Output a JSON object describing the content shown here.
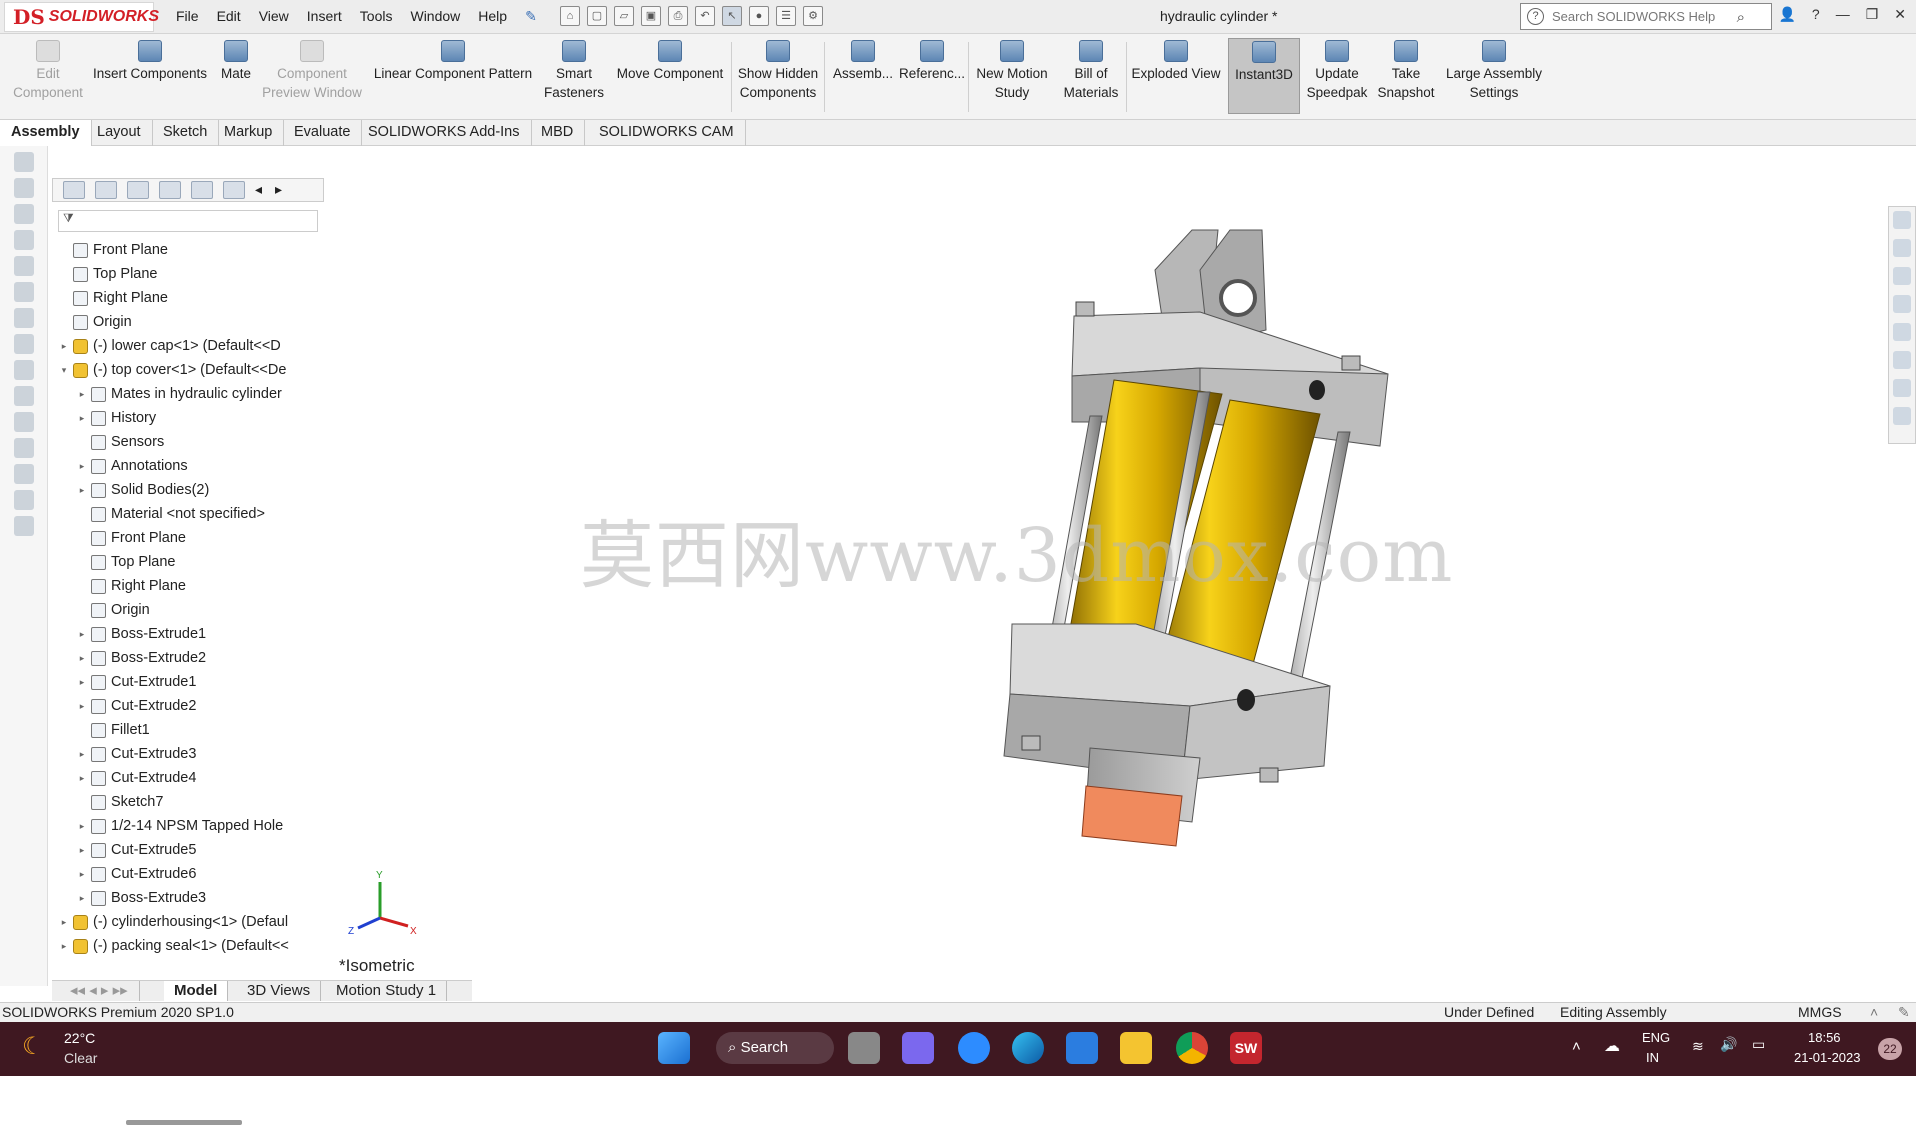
{
  "app": {
    "logo_mark": "DS",
    "logo_text": "SOLIDWORKS",
    "document_title": "hydraulic cylinder *",
    "menus": [
      "File",
      "Edit",
      "View",
      "Insert",
      "Tools",
      "Window",
      "Help"
    ],
    "search_placeholder": "Search SOLIDWORKS Help"
  },
  "ribbon": {
    "edit_component": [
      "Edit",
      "Component"
    ],
    "insert_components": "Insert Components",
    "mate": "Mate",
    "component_preview": [
      "Component",
      "Preview Window"
    ],
    "linear_pattern": "Linear Component Pattern",
    "smart_fasteners": [
      "Smart",
      "Fasteners"
    ],
    "move_component": "Move Component",
    "show_hidden": [
      "Show Hidden",
      "Components"
    ],
    "assembly": "Assemb...",
    "reference": "Referenc...",
    "new_motion_study": [
      "New Motion",
      "Study"
    ],
    "bill_of_materials": [
      "Bill of",
      "Materials"
    ],
    "exploded_view": "Exploded View",
    "instant3d": "Instant3D",
    "update_speedpak": [
      "Update",
      "Speedpak"
    ],
    "take_snapshot": [
      "Take",
      "Snapshot"
    ],
    "large_assembly": [
      "Large Assembly",
      "Settings"
    ]
  },
  "command_tabs": [
    "Assembly",
    "Layout",
    "Sketch",
    "Markup",
    "Evaluate",
    "SOLIDWORKS Add-Ins",
    "MBD",
    "SOLIDWORKS CAM"
  ],
  "feature_tree": {
    "items": [
      {
        "label": "Front Plane",
        "level": 0,
        "toggle": ""
      },
      {
        "label": "Top Plane",
        "level": 0,
        "toggle": ""
      },
      {
        "label": "Right Plane",
        "level": 0,
        "toggle": ""
      },
      {
        "label": "Origin",
        "level": 0,
        "toggle": ""
      },
      {
        "label": "(-) lower cap<1> (Default<<D",
        "level": 0,
        "toggle": "▸",
        "part": true
      },
      {
        "label": "(-) top cover<1> (Default<<De",
        "level": 0,
        "toggle": "▾",
        "part": true
      },
      {
        "label": "Mates in hydraulic cylinder",
        "level": 1,
        "toggle": "▸"
      },
      {
        "label": "History",
        "level": 1,
        "toggle": "▸"
      },
      {
        "label": "Sensors",
        "level": 1,
        "toggle": ""
      },
      {
        "label": "Annotations",
        "level": 1,
        "toggle": "▸"
      },
      {
        "label": "Solid Bodies(2)",
        "level": 1,
        "toggle": "▸"
      },
      {
        "label": "Material <not specified>",
        "level": 1,
        "toggle": ""
      },
      {
        "label": "Front Plane",
        "level": 1,
        "toggle": ""
      },
      {
        "label": "Top Plane",
        "level": 1,
        "toggle": ""
      },
      {
        "label": "Right Plane",
        "level": 1,
        "toggle": ""
      },
      {
        "label": "Origin",
        "level": 1,
        "toggle": ""
      },
      {
        "label": "Boss-Extrude1",
        "level": 1,
        "toggle": "▸"
      },
      {
        "label": "Boss-Extrude2",
        "level": 1,
        "toggle": "▸"
      },
      {
        "label": "Cut-Extrude1",
        "level": 1,
        "toggle": "▸"
      },
      {
        "label": "Cut-Extrude2",
        "level": 1,
        "toggle": "▸"
      },
      {
        "label": "Fillet1",
        "level": 1,
        "toggle": ""
      },
      {
        "label": "Cut-Extrude3",
        "level": 1,
        "toggle": "▸"
      },
      {
        "label": "Cut-Extrude4",
        "level": 1,
        "toggle": "▸"
      },
      {
        "label": "Sketch7",
        "level": 1,
        "toggle": ""
      },
      {
        "label": "1/2-14 NPSM Tapped Hole",
        "level": 1,
        "toggle": "▸"
      },
      {
        "label": "Cut-Extrude5",
        "level": 1,
        "toggle": "▸"
      },
      {
        "label": "Cut-Extrude6",
        "level": 1,
        "toggle": "▸"
      },
      {
        "label": "Boss-Extrude3",
        "level": 1,
        "toggle": "▸"
      },
      {
        "label": "(-) cylinderhousing<1> (Defaul",
        "level": 0,
        "toggle": "▸",
        "part": true
      },
      {
        "label": "(-) packing seal<1> (Default<<",
        "level": 0,
        "toggle": "▸",
        "part": true
      }
    ]
  },
  "viewport": {
    "view_name": "*Isometric",
    "watermark": "莫西网www.3dmox.com",
    "triad": {
      "x": "X",
      "y": "Y",
      "z": "Z"
    }
  },
  "bottom_tabs": [
    "Model",
    "3D Views",
    "Motion Study 1"
  ],
  "status_bar": {
    "product": "SOLIDWORKS Premium 2020 SP1.0",
    "state": "Under Defined",
    "mode": "Editing Assembly",
    "units": "MMGS"
  },
  "taskbar": {
    "temperature": "22°C",
    "weather": "Clear",
    "search_label": "Search",
    "lang": "ENG",
    "region": "IN",
    "time": "18:56",
    "date": "21-01-2023",
    "badge": "22"
  }
}
